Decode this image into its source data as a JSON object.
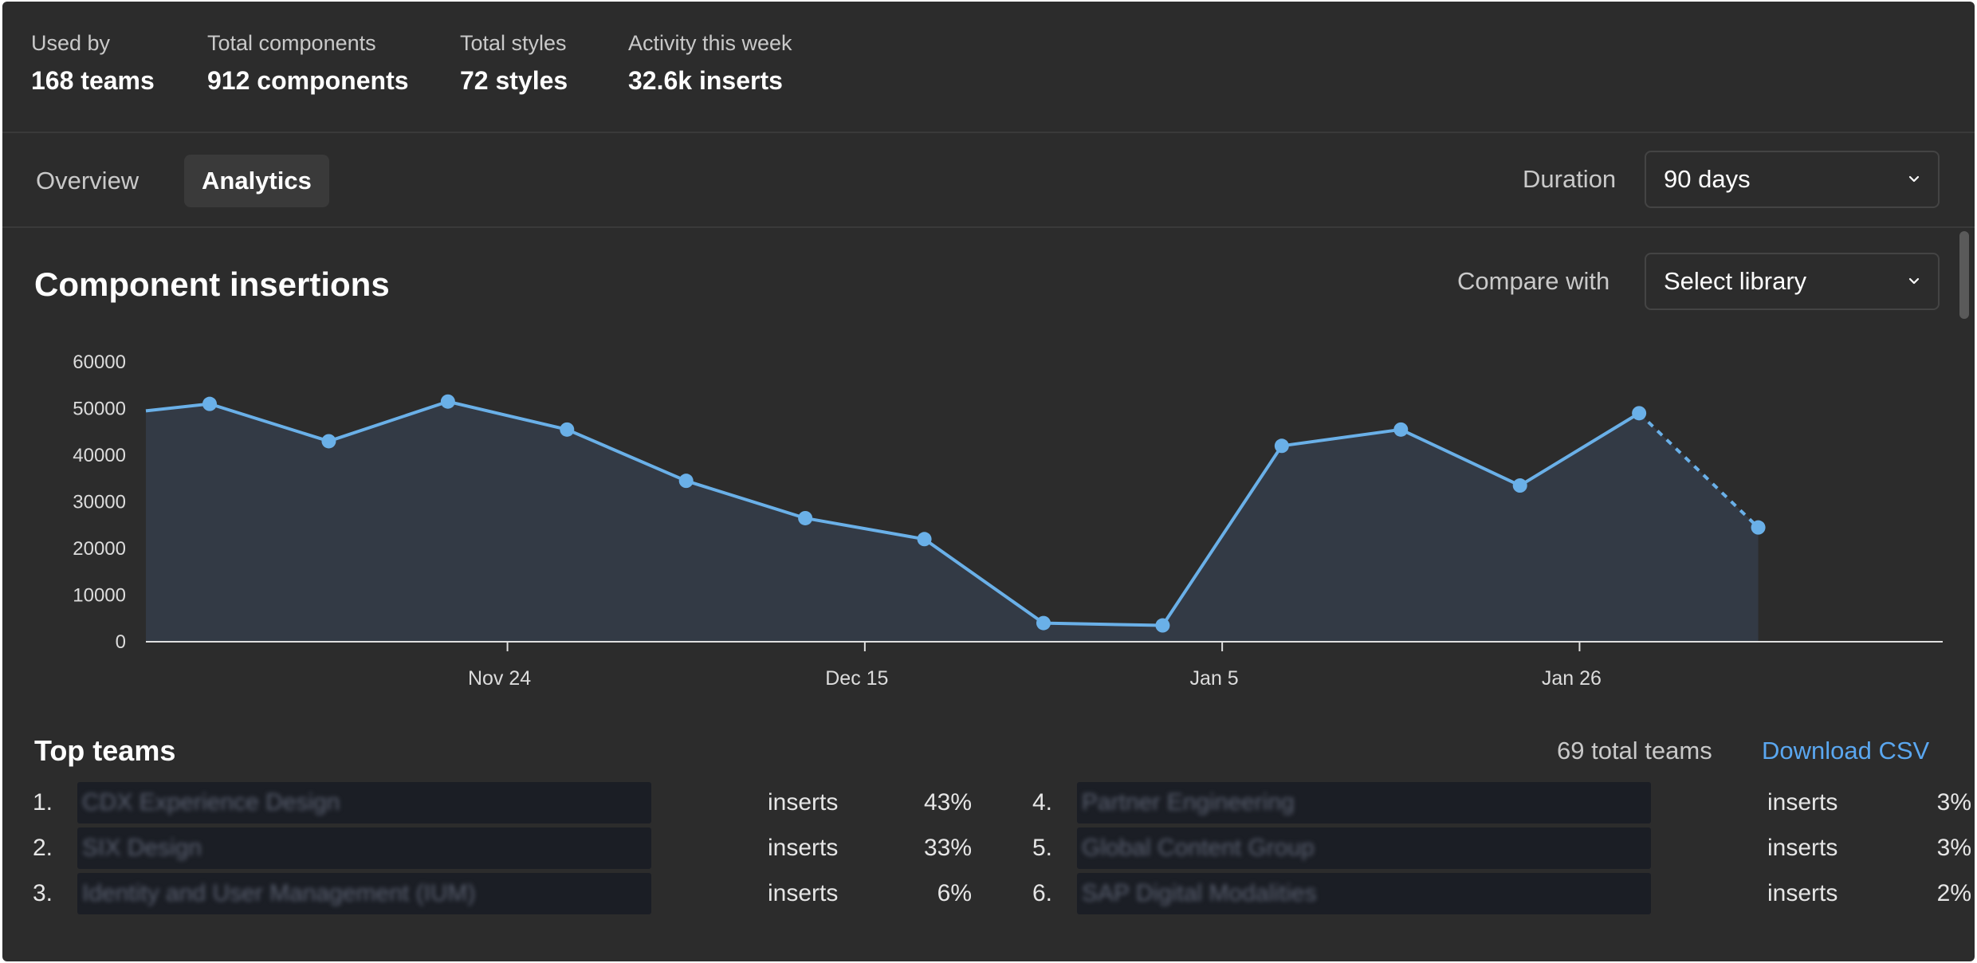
{
  "stats": [
    {
      "label": "Used by",
      "value": "168 teams"
    },
    {
      "label": "Total components",
      "value": "912 components"
    },
    {
      "label": "Total styles",
      "value": "72 styles"
    },
    {
      "label": "Activity this week",
      "value": "32.6k inserts"
    }
  ],
  "tabs": [
    {
      "label": "Overview",
      "active": false
    },
    {
      "label": "Analytics",
      "active": true
    }
  ],
  "duration": {
    "label": "Duration",
    "value": "90 days"
  },
  "compare": {
    "label": "Compare with",
    "value": "Select library"
  },
  "section_title": "Component insertions",
  "chart_data": {
    "type": "area",
    "title": "Component insertions",
    "xlabel": "",
    "ylabel": "",
    "ylim": [
      0,
      60000
    ],
    "y_ticks": [
      0,
      10000,
      20000,
      30000,
      40000,
      50000,
      60000
    ],
    "x_tick_labels": [
      "Nov 24",
      "Dec 15",
      "Jan 5",
      "Jan 26"
    ],
    "x_tick_index": [
      2.5,
      5.5,
      8.5,
      11.5
    ],
    "points": [
      49500,
      51000,
      43000,
      51500,
      45500,
      34500,
      26500,
      22000,
      4000,
      3500,
      42000,
      45500,
      33500,
      49000,
      24500
    ],
    "start_index": -0.5,
    "projected_from_index": 12,
    "grid": false,
    "colors": {
      "line": "#6ab0e8",
      "fill": "#333a45"
    }
  },
  "teams": {
    "title": "Top teams",
    "total": "69 total teams",
    "download": "Download CSV",
    "metric": "inserts",
    "rows": [
      {
        "rank": "1.",
        "name": "CDX Experience Design",
        "pct": "43%"
      },
      {
        "rank": "2.",
        "name": "SIX Design",
        "pct": "33%"
      },
      {
        "rank": "3.",
        "name": "Identity and User Management (IUM)",
        "pct": "6%"
      },
      {
        "rank": "4.",
        "name": "Partner Engineering",
        "pct": "3%"
      },
      {
        "rank": "5.",
        "name": "Global Content Group",
        "pct": "3%"
      },
      {
        "rank": "6.",
        "name": "SAP Digital Modalities",
        "pct": "2%"
      }
    ]
  }
}
